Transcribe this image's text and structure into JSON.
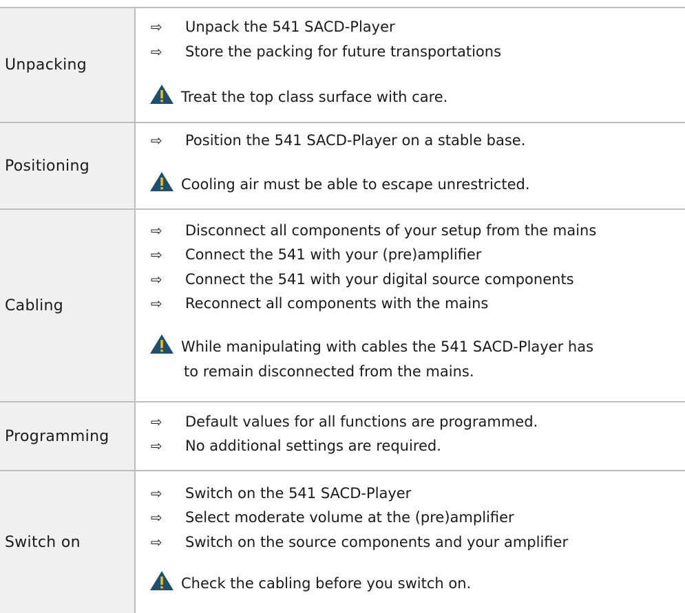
{
  "sections": [
    {
      "label": "Unpacking",
      "steps": [
        "Unpack the 541 SACD-Player",
        "Store the packing for future transportations"
      ],
      "warning": [
        "Treat the top class surface with care."
      ]
    },
    {
      "label": "Positioning",
      "steps": [
        "Position the 541 SACD-Player on a stable base."
      ],
      "warning": [
        "Cooling air must be able to escape unrestricted."
      ]
    },
    {
      "label": "Cabling",
      "steps": [
        "Disconnect all components of your setup from the mains",
        "Connect the 541 with your (pre)amplifier",
        "Connect the 541 with your digital source components",
        "Reconnect all components with the mains"
      ],
      "warning": [
        "While manipulating with cables the 541 SACD-Player has",
        "to remain disconnected from the mains."
      ]
    },
    {
      "label": "Programming",
      "steps": [
        "Default values for all functions are programmed.",
        "No additional settings are required."
      ],
      "warning": []
    },
    {
      "label": "Switch on",
      "steps": [
        "Switch on the 541 SACD-Player",
        "Select moderate volume at the (pre)amplifier",
        "Switch on the source components and your amplifier"
      ],
      "warning": [
        "Check the cabling before you switch on."
      ]
    }
  ],
  "icons": {
    "step": "right-arrow-icon",
    "warning": "warning-triangle-icon"
  },
  "colors": {
    "label_bg": "#f0f0f0",
    "border": "#bdbdbd",
    "warning_icon": "#1f4e6e"
  }
}
